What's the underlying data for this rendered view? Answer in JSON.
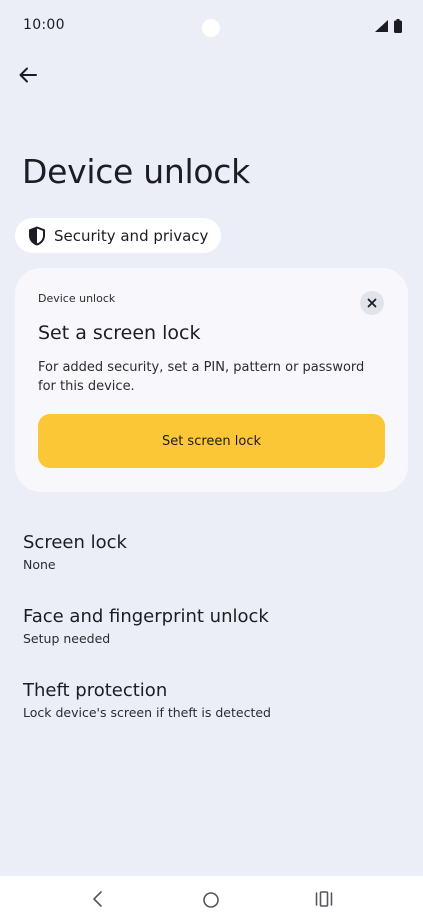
{
  "status_bar": {
    "time": "10:00",
    "icons": [
      "signal-icon",
      "battery-icon"
    ]
  },
  "header": {
    "back_icon": "arrow-left-icon",
    "title": "Device unlock"
  },
  "breadcrumb": {
    "icon": "shield-icon",
    "label": "Security and privacy"
  },
  "card": {
    "eyebrow": "Device unlock",
    "title": "Set a screen lock",
    "description": "For added security, set a PIN, pattern or password for this device.",
    "button_label": "Set screen lock",
    "close_icon": "close-icon",
    "accent_color": "#fcc736"
  },
  "settings": [
    {
      "title": "Screen lock",
      "subtitle": "None"
    },
    {
      "title": "Face and fingerprint unlock",
      "subtitle": "Setup needed"
    },
    {
      "title": "Theft protection",
      "subtitle": "Lock device's screen if theft is detected"
    }
  ],
  "nav_bar": {
    "icons": [
      "nav-back-icon",
      "nav-home-icon",
      "nav-recents-icon"
    ]
  }
}
